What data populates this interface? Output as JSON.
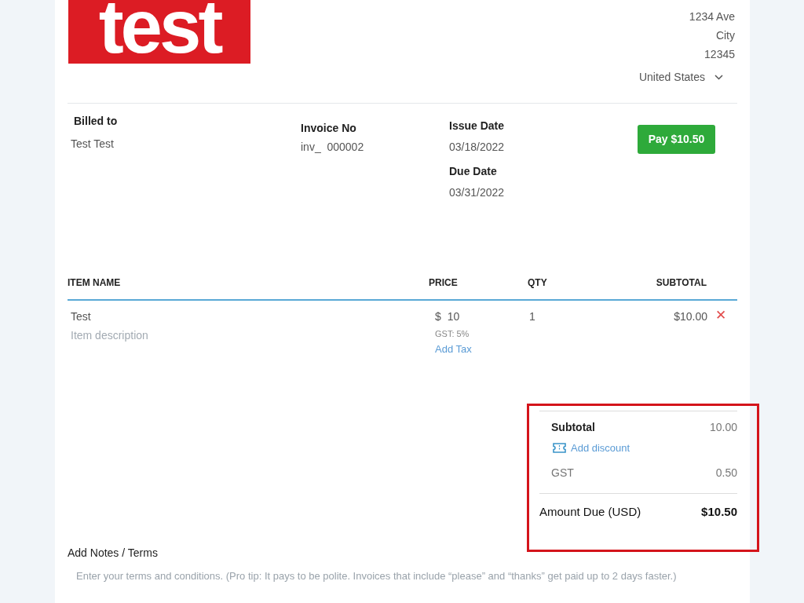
{
  "logo": {
    "text": "test"
  },
  "sender_address": [
    "1234 Ave",
    "City",
    "12345"
  ],
  "country": {
    "value": "United States"
  },
  "billed_to": {
    "label": "Billed to",
    "value": "Test Test"
  },
  "invoice_no": {
    "label": "Invoice No",
    "value": "inv_  000002"
  },
  "issue_date": {
    "label": "Issue Date",
    "value": "03/18/2022"
  },
  "due_date": {
    "label": "Due Date",
    "value": "03/31/2022"
  },
  "pay_button": "Pay $10.50",
  "table": {
    "columns": [
      "ITEM NAME",
      "PRICE",
      "QTY",
      "SUBTOTAL"
    ],
    "rows": [
      {
        "name": "Test",
        "description_placeholder": "Item description",
        "currency": "$",
        "price": "10",
        "tax": "GST: 5%",
        "add_tax": "Add Tax",
        "qty": "1",
        "subtotal": "$10.00",
        "remove": "✕"
      }
    ]
  },
  "totals": {
    "subtotal_label": "Subtotal",
    "subtotal": "10.00",
    "add_discount": "Add discount",
    "tax_label": "GST",
    "tax": "0.50",
    "amount_due_label": "Amount Due (USD)",
    "amount_due": "$10.50"
  },
  "notes": {
    "label": "Add Notes / Terms",
    "placeholder": "Enter your terms and conditions. (Pro tip: It pays to be polite. Invoices that include “please” and “thanks” get paid up to 2 days faster.)"
  }
}
